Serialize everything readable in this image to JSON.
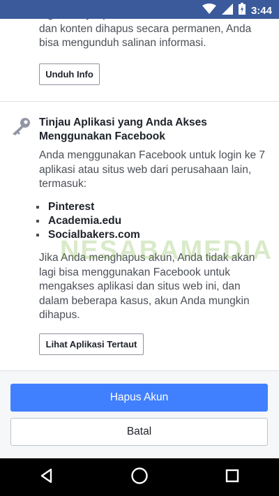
{
  "status_bar": {
    "time": "3:44"
  },
  "previous_section": {
    "text": "login menyimpan informasi ini sebelum akun dan konten dihapus secara permanen, Anda bisa mengunduh salinan informasi.",
    "button_label": "Unduh Info"
  },
  "apps_section": {
    "title": "Tinjau Aplikasi yang Anda Akses Menggunakan Facebook",
    "description": "Anda menggunakan Facebook untuk login ke 7 aplikasi atau situs web dari perusahaan lain, termasuk:",
    "apps": [
      "Pinterest",
      "Academia.edu",
      "Socialbakers.com"
    ],
    "warning": "Jika Anda menghapus akun, Anda tidak akan lagi bisa menggunakan Facebook untuk mengakses aplikasi dan situs web ini, dan dalam beberapa kasus, akun Anda mungkin dihapus.",
    "button_label": "Lihat Aplikasi Tertaut"
  },
  "watermark": "NESABAMEDIA",
  "footer": {
    "delete_label": "Hapus Akun",
    "cancel_label": "Batal"
  },
  "colors": {
    "status_bar": "#3a5a9b",
    "primary_button": "#4080ff",
    "nav_bar": "#000000"
  },
  "icons": {
    "section": "key-icon",
    "nav": [
      "back-icon",
      "home-icon",
      "recents-icon"
    ],
    "status": [
      "wifi-icon",
      "signal-icon",
      "battery-icon"
    ]
  }
}
